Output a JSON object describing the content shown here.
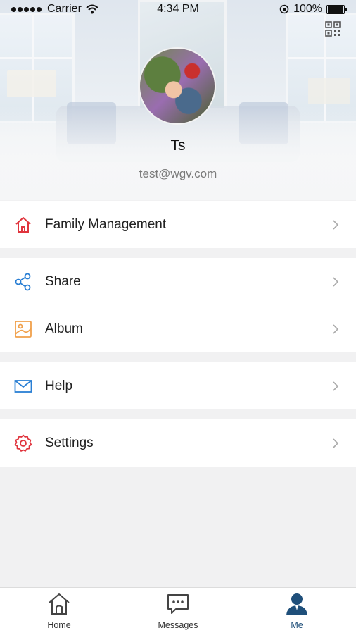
{
  "status_bar": {
    "carrier": "Carrier",
    "time": "4:34 PM",
    "battery": "100%"
  },
  "profile": {
    "name": "Ts",
    "email": "test@wgv.com"
  },
  "menu": {
    "family": "Family Management",
    "share": "Share",
    "album": "Album",
    "help": "Help",
    "settings": "Settings"
  },
  "tabs": {
    "home": "Home",
    "messages": "Messages",
    "me": "Me"
  },
  "colors": {
    "accent_red": "#e0343d",
    "accent_blue": "#2a7fd4",
    "accent_orange": "#f0a04b",
    "active_tab": "#1f4f7a"
  }
}
